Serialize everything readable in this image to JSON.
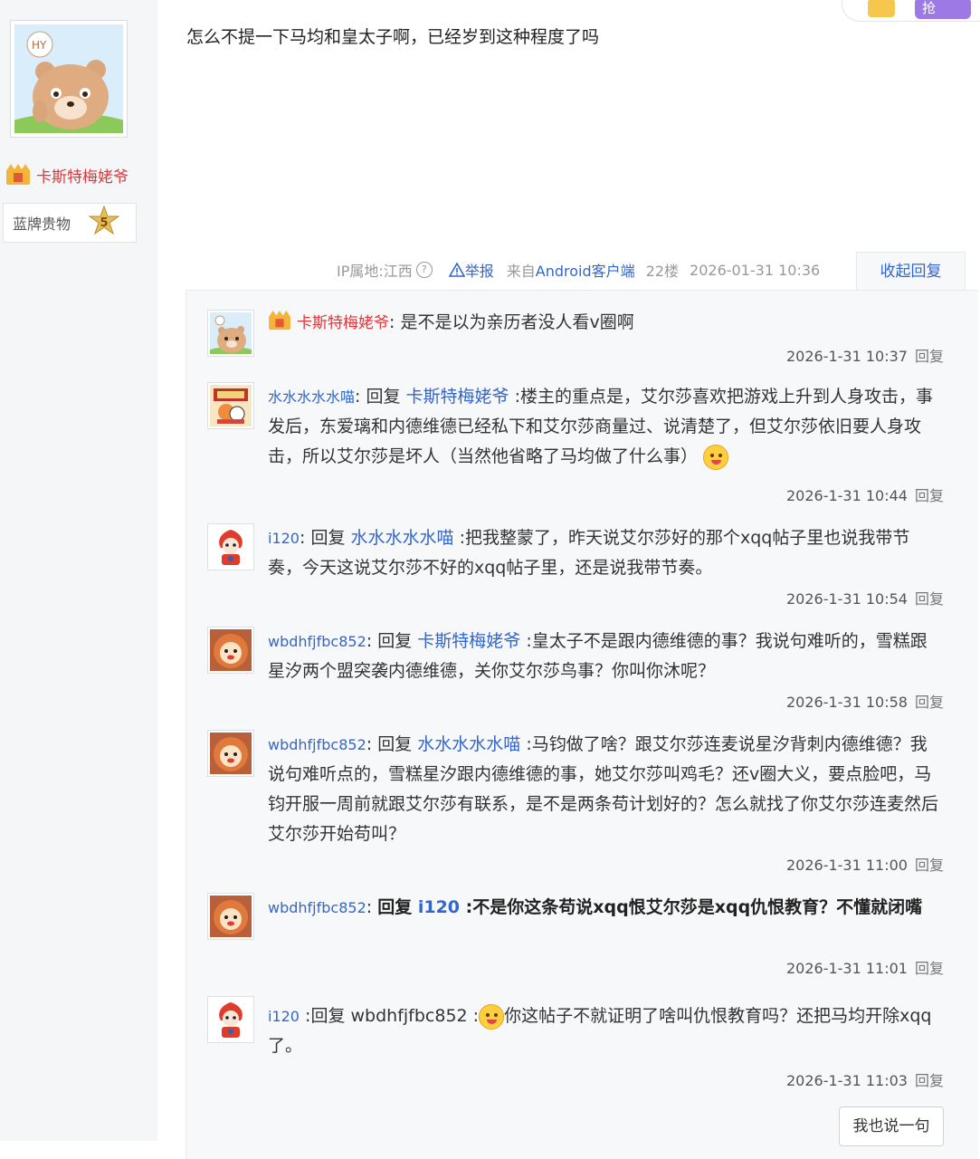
{
  "author": {
    "name": "卡斯特梅姥爷",
    "level_name": "蓝牌贵物",
    "level": "5"
  },
  "top_bar": {
    "button_label": "抢"
  },
  "post": {
    "content": "怎么不提一下马均和皇太子啊，已经岁到这种程度了吗",
    "ip_label": "IP属地:江西",
    "help": "?",
    "report": "举报",
    "source_prefix": "来自",
    "source_client": "Android客户端",
    "floor": "22楼",
    "datetime": "2026-01-31 10:36",
    "collapse_label": "收起回复"
  },
  "replies": [
    {
      "user": "卡斯特梅姥爷",
      "sep": ":",
      "text": " 是不是以为亲历者没人看v圈啊",
      "time": "2026-1-31 10:37",
      "reply_label": "回复"
    },
    {
      "user": "水水水水水喵",
      "sep": ":",
      "prefix": "回复",
      "target": "卡斯特梅姥爷",
      "text": ":楼主的重点是，艾尔莎喜欢把游戏上升到人身攻击，事发后，东爱璃和内德维德已经私下和艾尔莎商量过、说清楚了，但艾尔莎依旧要人身攻击，所以艾尔莎是坏人（当然他省略了马均做了什么事）",
      "time": "2026-1-31 10:44",
      "reply_label": "回复"
    },
    {
      "user": "i120",
      "sep": ":",
      "prefix": "回复",
      "target": "水水水水水喵",
      "text": ":把我整蒙了，昨天说艾尔莎好的那个xqq帖子里也说我带节奏，今天这说艾尔莎不好的xqq帖子里，还是说我带节奏。",
      "time": "2026-1-31 10:54",
      "reply_label": "回复"
    },
    {
      "user": "wbdhfjfbc852",
      "sep": ":",
      "prefix": "回复",
      "target": "卡斯特梅姥爷",
      "text": ":皇太子不是跟内德维德的事？我说句难听的，雪糕跟星汐两个盟突袭内德维德，关你艾尔莎鸟事？你叫你沐呢？",
      "time": "2026-1-31 10:58",
      "reply_label": "回复"
    },
    {
      "user": "wbdhfjfbc852",
      "sep": ":",
      "prefix": "回复",
      "target": "水水水水水喵",
      "text": ":马钧做了啥？跟艾尔莎连麦说星汐背刺内德维德？我说句难听点的，雪糕星汐跟内德维德的事，她艾尔莎叫鸡毛？还v圈大义，要点脸吧，马钧开服一周前就跟艾尔莎有联系，是不是两条苟计划好的？怎么就找了你艾尔莎连麦然后艾尔莎开始苟叫？",
      "time": "2026-1-31 11:00",
      "reply_label": "回复"
    },
    {
      "user": "wbdhfjfbc852",
      "sep": ":",
      "prefix": "回复",
      "target": "i120",
      "text": ":不是你这条苟说xqq恨艾尔莎是xqq仇恨教育？不懂就闭嘴",
      "time": "2026-1-31 11:01",
      "reply_label": "回复"
    },
    {
      "user": "i120",
      "sep": " :",
      "prefix": "回复",
      "target": "wbdhfjfbc852",
      "text_pre": " :",
      "text": "你这帖子不就证明了啥叫仇恨教育吗？还把马均开除xqq了。",
      "time": "2026-1-31 11:03",
      "reply_label": "回复"
    }
  ],
  "say_button": "我也说一句",
  "colors": {
    "link": "#3366cc",
    "author_red": "#e0363a",
    "panel_bg": "#f7f8fa"
  }
}
